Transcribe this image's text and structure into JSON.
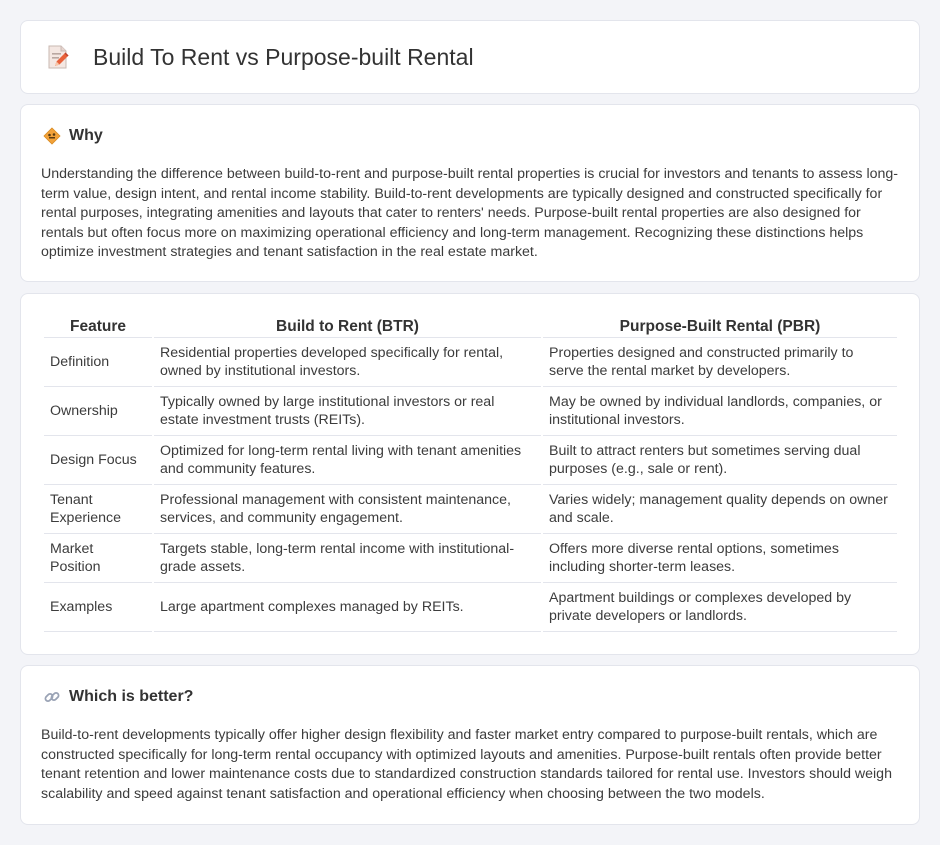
{
  "header": {
    "title": "Build To Rent vs Purpose-built Rental",
    "icon": "document-pencil-icon"
  },
  "why": {
    "title": "Why",
    "icon": "warning-sign-icon",
    "text": "Understanding the difference between build-to-rent and purpose-built rental properties is crucial for investors and tenants to assess long-term value, design intent, and rental income stability. Build-to-rent developments are typically designed and constructed specifically for rental purposes, integrating amenities and layouts that cater to renters' needs. Purpose-built rental properties are also designed for rentals but often focus more on maximizing operational efficiency and long-term management. Recognizing these distinctions helps optimize investment strategies and tenant satisfaction in the real estate market."
  },
  "table": {
    "headers": [
      "Feature",
      "Build to Rent (BTR)",
      "Purpose-Built Rental (PBR)"
    ],
    "rows": [
      [
        "Definition",
        "Residential properties developed specifically for rental, owned by institutional investors.",
        "Properties designed and constructed primarily to serve the rental market by developers."
      ],
      [
        "Ownership",
        "Typically owned by large institutional investors or real estate investment trusts (REITs).",
        "May be owned by individual landlords, companies, or institutional investors."
      ],
      [
        "Design Focus",
        "Optimized for long-term rental living with tenant amenities and community features.",
        "Built to attract renters but sometimes serving dual purposes (e.g., sale or rent)."
      ],
      [
        "Tenant Experience",
        "Professional management with consistent maintenance, services, and community engagement.",
        "Varies widely; management quality depends on owner and scale."
      ],
      [
        "Market Position",
        "Targets stable, long-term rental income with institutional-grade assets.",
        "Offers more diverse rental options, sometimes including shorter-term leases."
      ],
      [
        "Examples",
        "Large apartment complexes managed by REITs.",
        "Apartment buildings or complexes developed by private developers or landlords."
      ]
    ]
  },
  "better": {
    "title": "Which is better?",
    "icon": "link-icon",
    "text": "Build-to-rent developments typically offer higher design flexibility and faster market entry compared to purpose-built rentals, which are constructed specifically for long-term rental occupancy with optimized layouts and amenities. Purpose-built rentals often provide better tenant retention and lower maintenance costs due to standardized construction standards tailored for rental use. Investors should weigh scalability and speed against tenant satisfaction and operational efficiency when choosing between the two models."
  }
}
